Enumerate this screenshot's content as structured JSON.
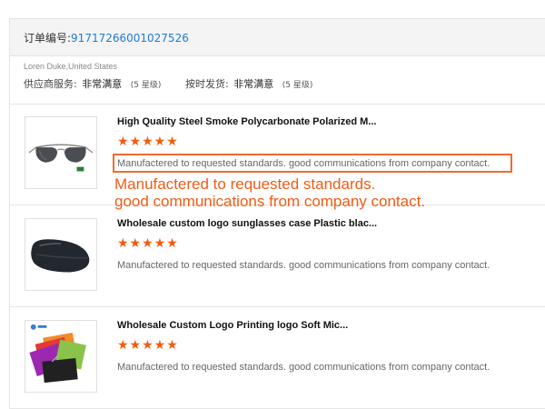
{
  "order": {
    "label": "订单编号:",
    "number": "91717266001027526"
  },
  "buyer": {
    "name_location": "Loren Duke,United States"
  },
  "ratings": [
    {
      "label": "供应商服务:",
      "value": "非常满意",
      "level": "(5 星级)"
    },
    {
      "label": "按时发货:",
      "value": "非常满意",
      "level": "(5 星级)"
    }
  ],
  "products": [
    {
      "title": "High Quality Steel Smoke Polycarbonate Polarized M...",
      "stars": "★★★★★",
      "rating": 5,
      "review": "Manufactered to requested standards.  good communications from company contact.",
      "image": "aviator-sunglasses-icon"
    },
    {
      "title": "Wholesale custom logo sunglasses case Plastic blac...",
      "stars": "★★★★★",
      "rating": 5,
      "review": "Manufactered to requested standards.  good communications from company contact.",
      "image": "glasses-case-icon"
    },
    {
      "title": "Wholesale Custom Logo Printing logo Soft Mic...",
      "stars": "★★★★★",
      "rating": 5,
      "review": "Manufactered to requested standards.  good communications from company contact.",
      "image": "microfiber-pouches-icon"
    }
  ],
  "annotation": {
    "line1": "Manufactered to requested standards.",
    "line2": "good communications from company contact."
  },
  "colors": {
    "accent_orange": "#f65a0c",
    "annotation_orange": "#f35b14",
    "link_blue": "#1f7bd6"
  }
}
